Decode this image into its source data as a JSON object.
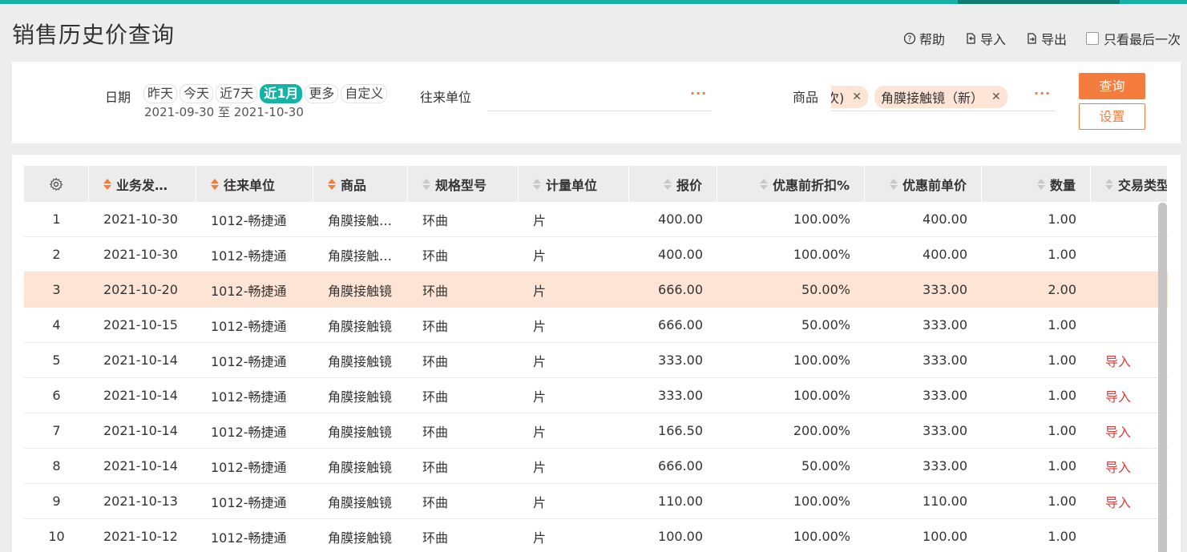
{
  "title": "销售历史价查询",
  "top_actions": {
    "help": "帮助",
    "import": "导入",
    "export": "导出",
    "last_only": "只看最后一次"
  },
  "filters": {
    "date_label": "日期",
    "date_chips": [
      "昨天",
      "今天",
      "近7天",
      "近1月",
      "更多",
      "自定义"
    ],
    "active_chip": "近1月",
    "date_range": "2021-09-30 至 2021-10-30",
    "partner_label": "往来单位",
    "partner_value": "",
    "product_label": "商品",
    "product_tags": [
      "次)",
      "角膜接触镜（新）"
    ],
    "more_glyph": "···",
    "query_button": "查询",
    "settings_button": "设置"
  },
  "table": {
    "columns": [
      "业务发…",
      "往来单位",
      "商品",
      "规格型号",
      "计量单位",
      "报价",
      "优惠前折扣%",
      "优惠前单价",
      "数量",
      "交易类型"
    ],
    "selected_row": 3,
    "rows": [
      [
        "1",
        "2021-10-30",
        "1012-畅捷通",
        "角膜接触…",
        "环曲",
        "片",
        "400.00",
        "100.00%",
        "400.00",
        "1.00",
        ""
      ],
      [
        "2",
        "2021-10-30",
        "1012-畅捷通",
        "角膜接触…",
        "环曲",
        "片",
        "400.00",
        "100.00%",
        "400.00",
        "1.00",
        ""
      ],
      [
        "3",
        "2021-10-20",
        "1012-畅捷通",
        "角膜接触镜",
        "环曲",
        "片",
        "666.00",
        "50.00%",
        "333.00",
        "2.00",
        ""
      ],
      [
        "4",
        "2021-10-15",
        "1012-畅捷通",
        "角膜接触镜",
        "环曲",
        "片",
        "666.00",
        "50.00%",
        "333.00",
        "1.00",
        ""
      ],
      [
        "5",
        "2021-10-14",
        "1012-畅捷通",
        "角膜接触镜",
        "环曲",
        "片",
        "333.00",
        "100.00%",
        "333.00",
        "1.00",
        "导入"
      ],
      [
        "6",
        "2021-10-14",
        "1012-畅捷通",
        "角膜接触镜",
        "环曲",
        "片",
        "333.00",
        "100.00%",
        "333.00",
        "1.00",
        "导入"
      ],
      [
        "7",
        "2021-10-14",
        "1012-畅捷通",
        "角膜接触镜",
        "环曲",
        "片",
        "166.50",
        "200.00%",
        "333.00",
        "1.00",
        "导入"
      ],
      [
        "8",
        "2021-10-14",
        "1012-畅捷通",
        "角膜接触镜",
        "环曲",
        "片",
        "666.00",
        "50.00%",
        "333.00",
        "1.00",
        "导入"
      ],
      [
        "9",
        "2021-10-13",
        "1012-畅捷通",
        "角膜接触镜",
        "环曲",
        "片",
        "110.00",
        "100.00%",
        "110.00",
        "1.00",
        "导入"
      ],
      [
        "10",
        "2021-10-12",
        "1012-畅捷通",
        "角膜接触镜",
        "环曲",
        "片",
        "100.00",
        "100.00%",
        "100.00",
        "1.00",
        ""
      ]
    ]
  },
  "colors": {
    "accent": "#14b3a5",
    "orange": "#f47c3c",
    "selected_row": "#fde4d4",
    "link_red": "#e33b3b"
  }
}
